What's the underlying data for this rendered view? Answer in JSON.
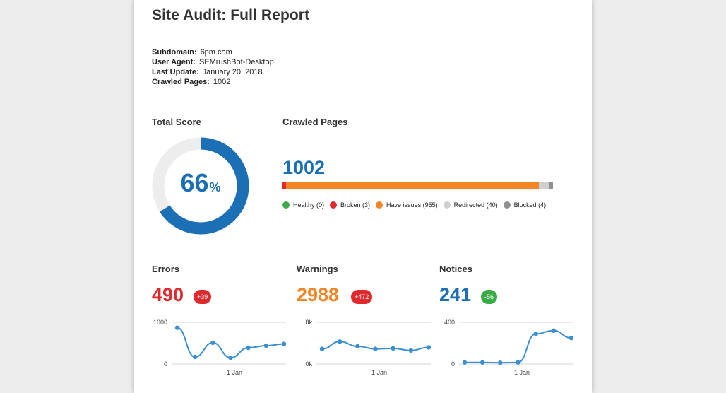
{
  "report": {
    "title": "Site Audit: Full Report",
    "meta": [
      {
        "label": "Subdomain:",
        "value": "6pm.com"
      },
      {
        "label": "User Agent:",
        "value": "SEMrushBot-Desktop"
      },
      {
        "label": "Last Update:",
        "value": "January 20, 2018"
      },
      {
        "label": "Crawled Pages:",
        "value": "1002"
      }
    ]
  },
  "total_score": {
    "heading": "Total Score",
    "value": "66",
    "unit": "%",
    "fraction": 0.66,
    "color": "#1a6fb5",
    "track_color": "#ededed"
  },
  "crawled_pages": {
    "heading": "Crawled Pages",
    "total": "1002",
    "segments": [
      {
        "name": "Healthy",
        "count": 0,
        "color": "#3aab47",
        "label": "Healthy (0)"
      },
      {
        "name": "Broken",
        "count": 3,
        "color": "#e0282d",
        "label": "Broken (3)"
      },
      {
        "name": "Have issues",
        "count": 955,
        "color": "#f28627",
        "label": "Have issues (955)"
      },
      {
        "name": "Redirected",
        "count": 40,
        "color": "#cfcfcf",
        "label": "Redirected (40)"
      },
      {
        "name": "Blocked",
        "count": 4,
        "color": "#8f8f8f",
        "label": "Blocked (4)"
      }
    ]
  },
  "metrics": [
    {
      "heading": "Errors",
      "value": "490",
      "value_color": "#e0282d",
      "delta": "+39",
      "delta_color": "#e0282d"
    },
    {
      "heading": "Warnings",
      "value": "2988",
      "value_color": "#f28627",
      "delta": "+472",
      "delta_color": "#e0282d"
    },
    {
      "heading": "Notices",
      "value": "241",
      "value_color": "#1a6fb5",
      "delta": "-56",
      "delta_color": "#3aab47"
    }
  ],
  "chart_data": [
    {
      "type": "line",
      "series_color": "#3b8fd0",
      "ylim": [
        0,
        1000
      ],
      "yticks": [
        "1000",
        "0"
      ],
      "xticks": [
        "1 Jan"
      ],
      "values": [
        870,
        170,
        510,
        150,
        390,
        440,
        480
      ]
    },
    {
      "type": "line",
      "series_color": "#3b8fd0",
      "ylim": [
        0,
        8000
      ],
      "yticks": [
        "8k",
        "0k"
      ],
      "xticks": [
        "1 Jan"
      ],
      "values": [
        2900,
        4300,
        3400,
        2900,
        3000,
        2600,
        3200
      ]
    },
    {
      "type": "line",
      "series_color": "#3b8fd0",
      "ylim": [
        0,
        400
      ],
      "yticks": [
        "400",
        "0"
      ],
      "xticks": [
        "1 Jan"
      ],
      "values": [
        15,
        15,
        12,
        15,
        290,
        320,
        250
      ]
    }
  ]
}
